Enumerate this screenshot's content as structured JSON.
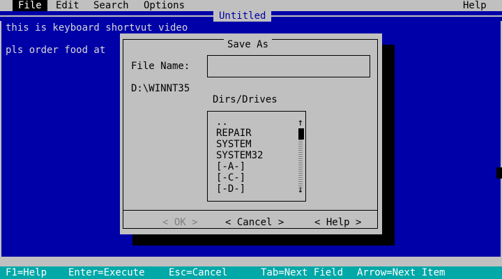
{
  "menu": {
    "items": [
      "File",
      "Edit",
      "Search",
      "Options"
    ],
    "help": "Help",
    "active": "File"
  },
  "document": {
    "title": "Untitled",
    "lines": [
      "this is keyboard shortvut video",
      "",
      "pls order food at"
    ]
  },
  "dialog": {
    "title": "Save As",
    "file_name_label": "File Name:",
    "file_name_value": "",
    "path": "D:\\WINNT35",
    "dirs_label": "Dirs/Drives",
    "dirs": [
      "..",
      "REPAIR",
      "SYSTEM",
      "SYSTEM32",
      "[-A-]",
      "[-C-]",
      "[-D-]"
    ],
    "scroll_up_icon": "↑",
    "scroll_down_icon": "↓",
    "buttons": {
      "ok": "< OK >",
      "cancel": "< Cancel >",
      "help": "< Help >"
    }
  },
  "status_bar": {
    "items": [
      "F1=Help",
      "Enter=Execute",
      "Esc=Cancel",
      "Tab=Next Field",
      "Arrow=Next Item"
    ]
  },
  "colors": {
    "background": "#0000a8",
    "menu_bar": "#c0c0c0",
    "dialog": "#c0c0c0",
    "status_bar": "#00a8a8"
  }
}
